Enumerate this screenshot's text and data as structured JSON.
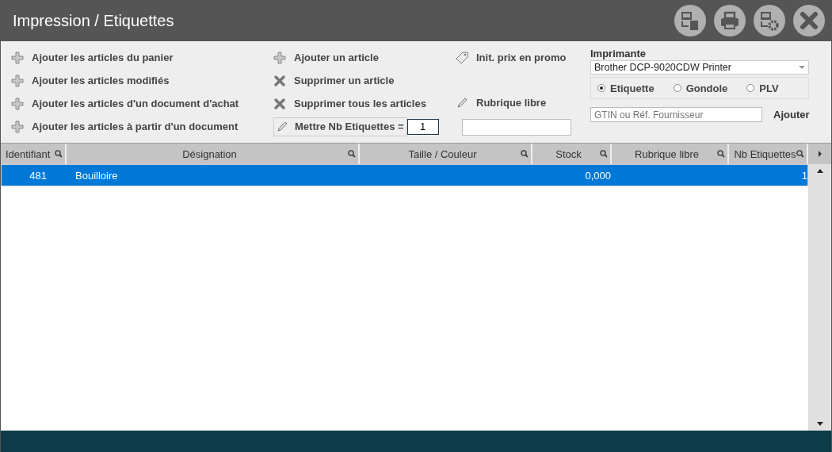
{
  "window": {
    "title": "Impression / Etiquettes"
  },
  "toolbar_buttons": [
    {
      "kind": "print-list"
    },
    {
      "kind": "print"
    },
    {
      "kind": "print-settings"
    },
    {
      "kind": "close"
    }
  ],
  "actions_left": [
    {
      "kind": "plus",
      "label": "Ajouter les articles du panier"
    },
    {
      "kind": "plus",
      "label": "Ajouter les articles modifiés"
    },
    {
      "kind": "plus",
      "label": "Ajouter les articles d'un document d'achat"
    },
    {
      "kind": "plus",
      "label": "Ajouter les articles à partir d'un document"
    }
  ],
  "actions_middle": [
    {
      "kind": "plus",
      "label": "Ajouter un article"
    },
    {
      "kind": "cross",
      "label": "Supprimer un article"
    },
    {
      "kind": "cross",
      "label": "Supprimer tous les articles"
    }
  ],
  "set_count": {
    "label": "Mettre Nb Etiquettes =",
    "value": "1"
  },
  "promo": {
    "label": "Init. prix en promo"
  },
  "free_field": {
    "label": "Rubrique libre"
  },
  "printer": {
    "label": "Imprimante",
    "value": "Brother DCP-9020CDW Printer"
  },
  "label_types": [
    {
      "label": "Etiquette",
      "selected": true
    },
    {
      "label": "Gondole",
      "selected": false
    },
    {
      "label": "PLV",
      "selected": false
    }
  ],
  "gtin": {
    "placeholder": "GTIN ou Réf. Fournisseur",
    "button": "Ajouter"
  },
  "table": {
    "columns": [
      "Identifiant",
      "Désignation",
      "Taille / Couleur",
      "Stock",
      "Rubrique libre",
      "Nb Etiquettes"
    ],
    "rows": [
      {
        "selected": true,
        "cells": [
          "481",
          "Bouilloire",
          "",
          "0,000",
          "",
          "1"
        ]
      }
    ]
  }
}
